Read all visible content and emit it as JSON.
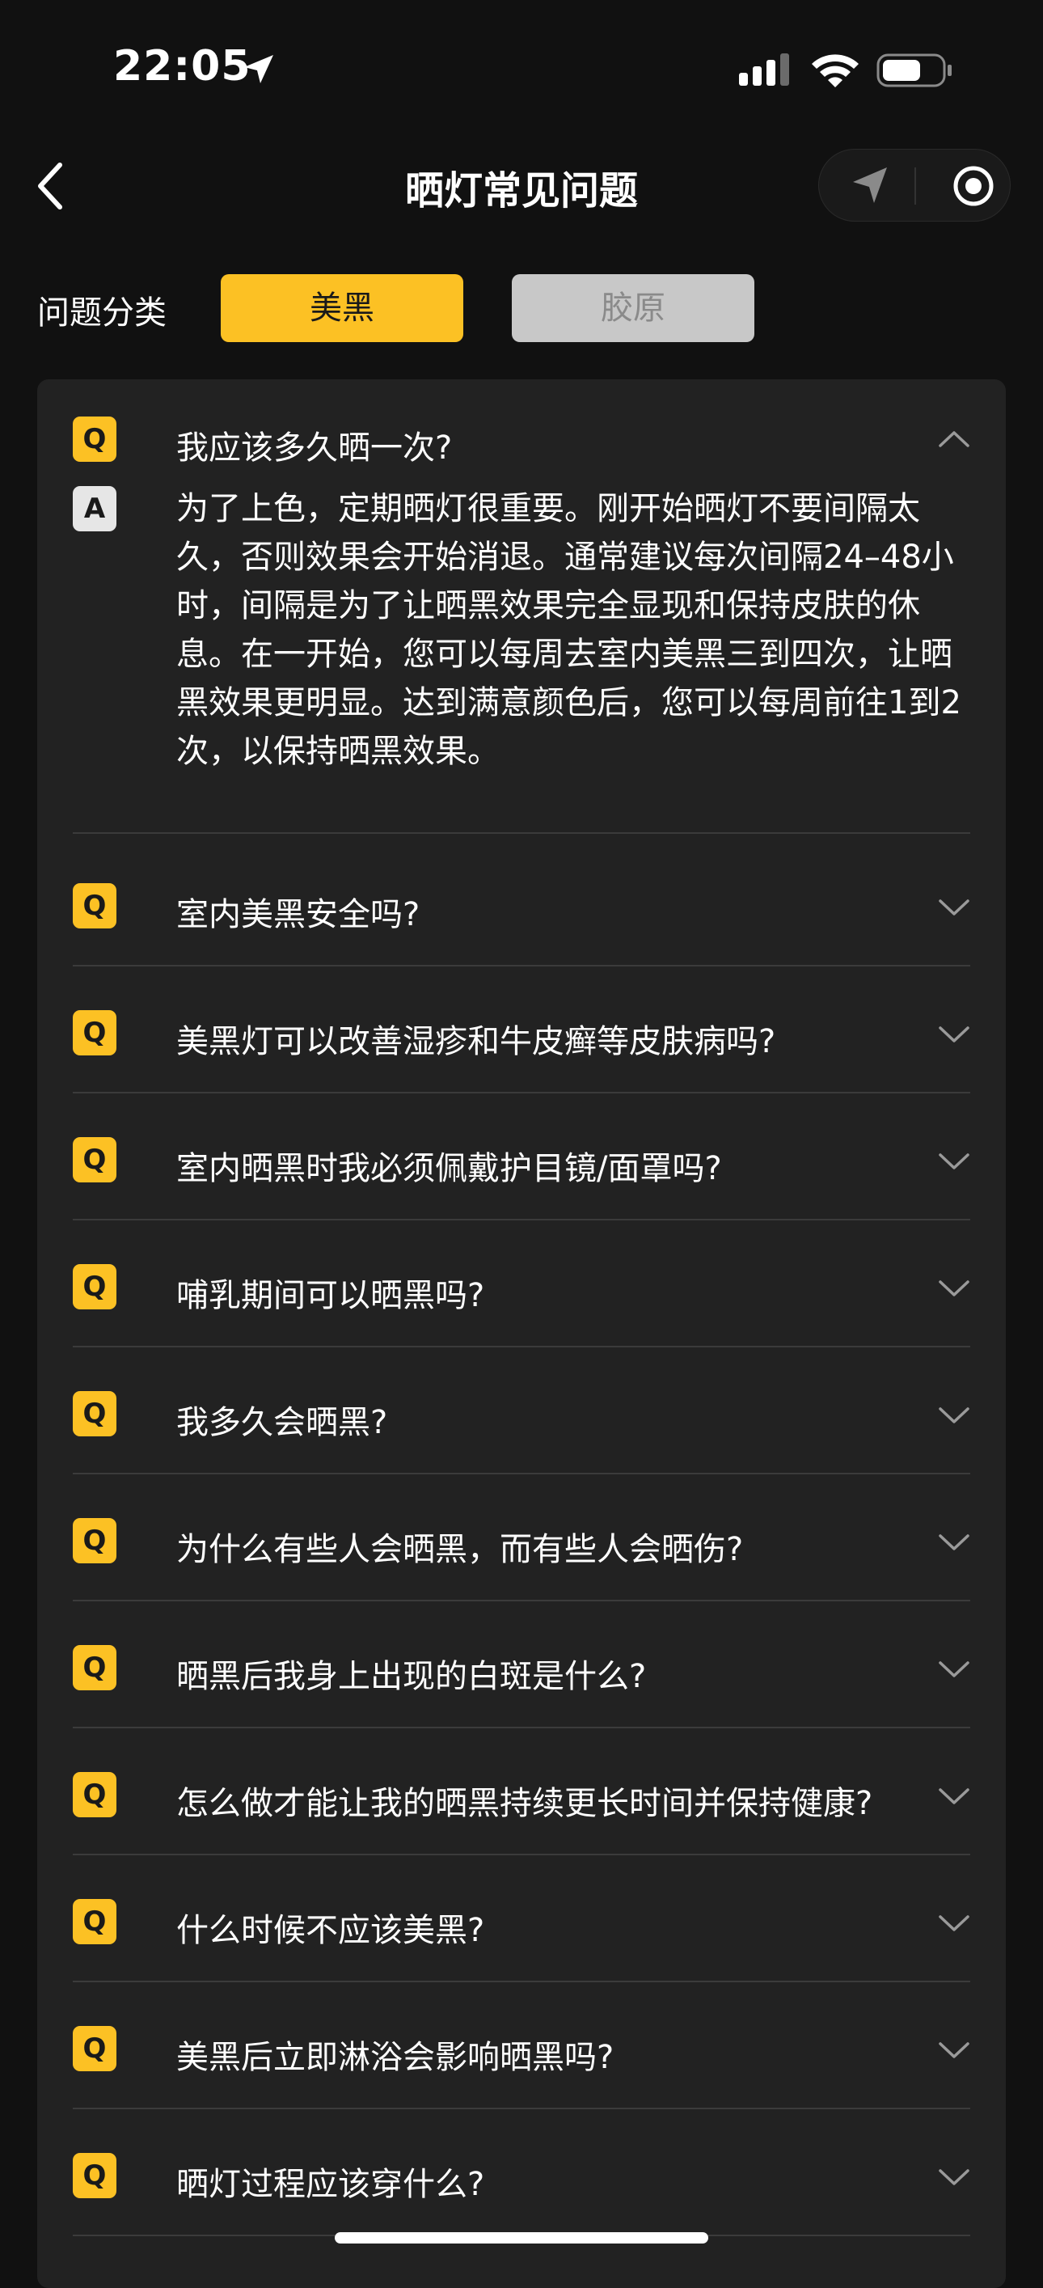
{
  "status": {
    "time": "22:05"
  },
  "nav": {
    "title": "晒灯常见问题",
    "back_icon": "chevron-left-icon",
    "capsule_icons": [
      "navigation-arrow-icon",
      "record-icon"
    ]
  },
  "category": {
    "label": "问题分类",
    "options": [
      "美黑",
      "胶原"
    ],
    "selected": "美黑"
  },
  "colors": {
    "accent": "#fcc124",
    "background": "#111111",
    "card": "#222222",
    "inactive_button": "#c8c8c8"
  },
  "faq": {
    "q_badge": "Q",
    "a_badge": "A",
    "expanded": {
      "question": "我应该多久晒一次?",
      "answer_lines": [
        "为了上色，定期晒灯很重要。刚开始晒灯不要间隔太",
        "久，否则效果会开始消退。通常建议每次间隔24–48小",
        "时，间隔是为了让晒黑效果完全显现和保持皮肤的休",
        "息。在一开始，您可以每周去室内美黑三到四次，让晒",
        "黑效果更明显。达到满意颜色后，您可以每周前往1到2",
        "次，以保持晒黑效果。"
      ]
    },
    "items": [
      "室内美黑安全吗?",
      "美黑灯可以改善湿疹和牛皮癣等皮肤病吗?",
      "室内晒黑时我必须佩戴护目镜/面罩吗?",
      "哺乳期间可以晒黑吗?",
      "我多久会晒黑?",
      "为什么有些人会晒黑，而有些人会晒伤?",
      "晒黑后我身上出现的白斑是什么?",
      "怎么做才能让我的晒黑持续更长时间并保持健康?",
      "什么时候不应该美黑?",
      "美黑后立即淋浴会影响晒黑吗?",
      "晒灯过程应该穿什么?"
    ]
  }
}
